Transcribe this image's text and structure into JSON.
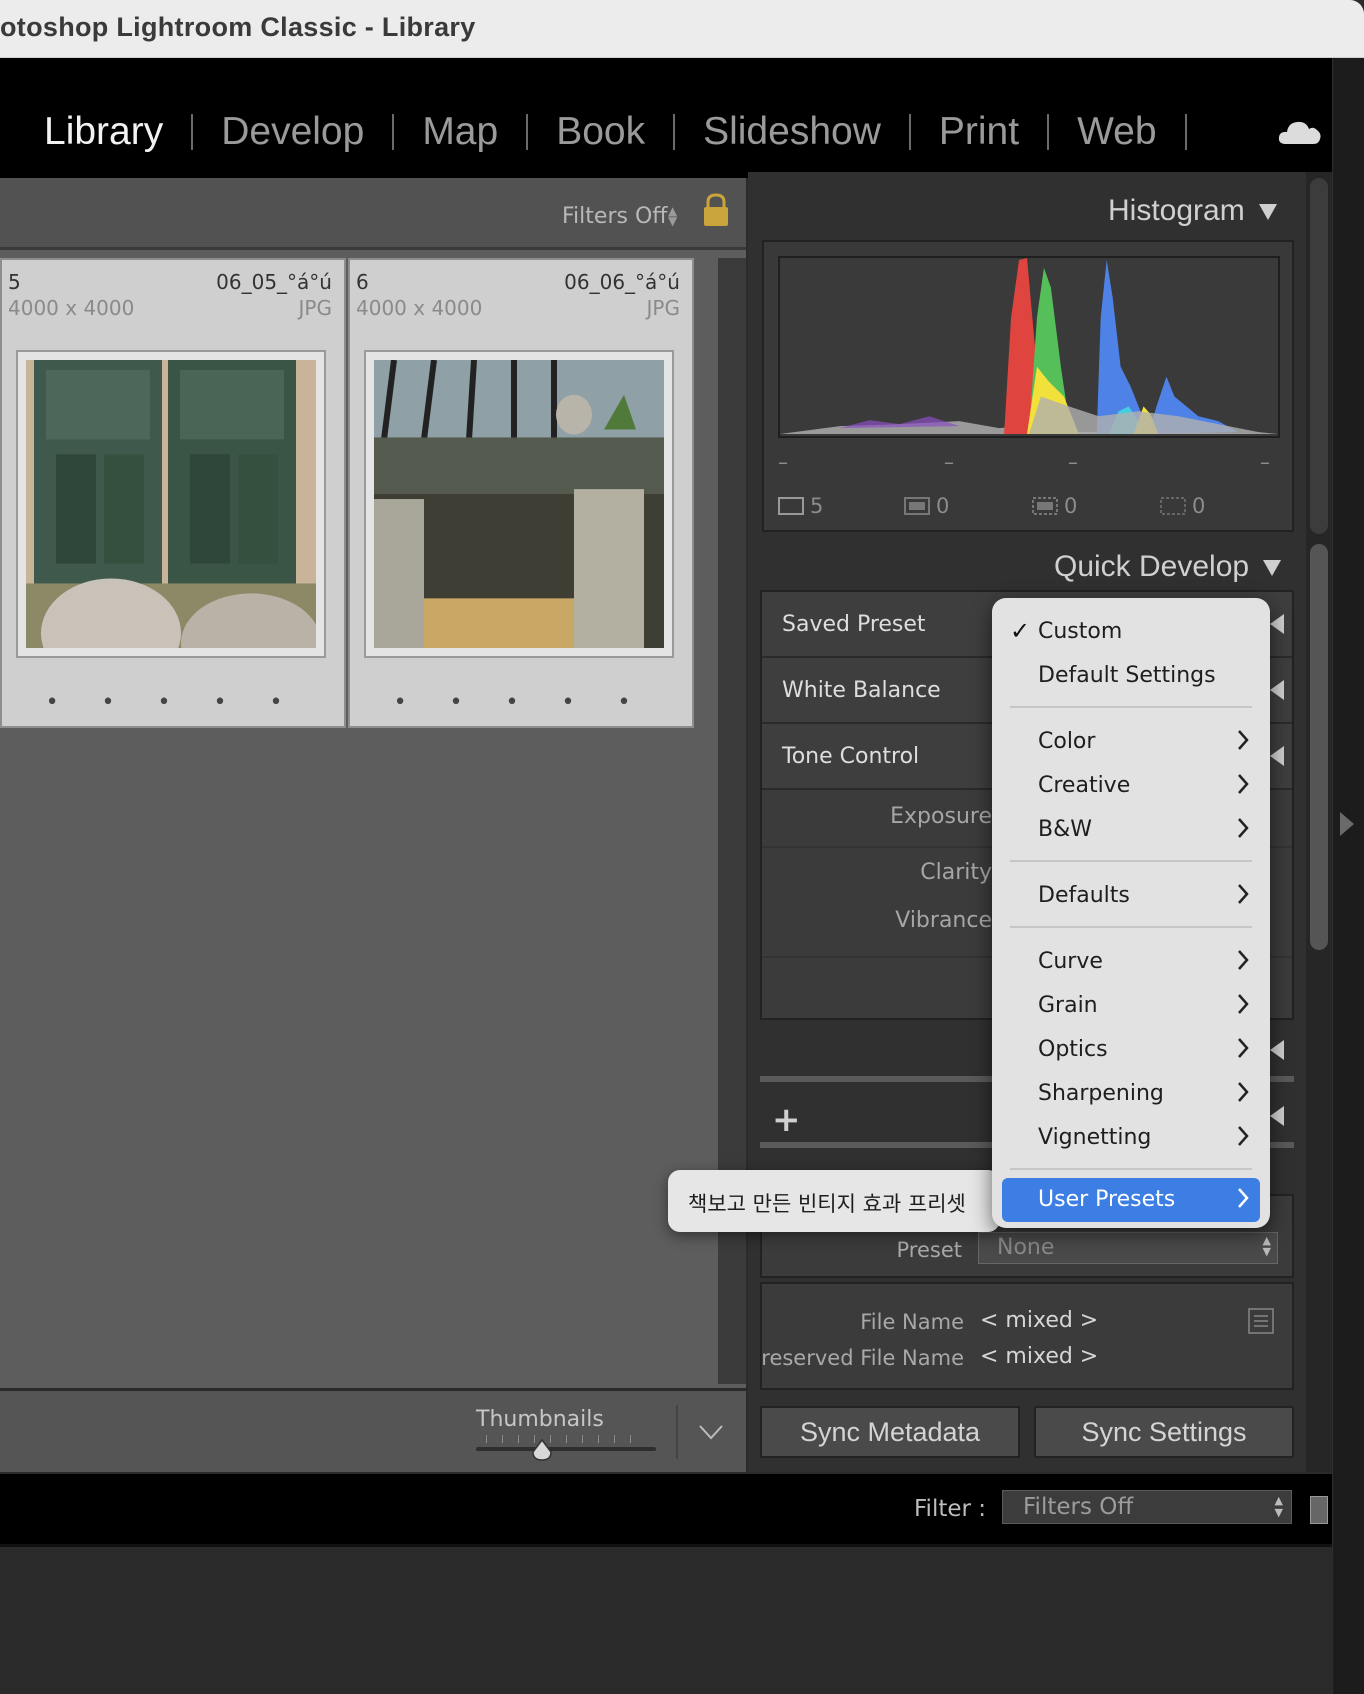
{
  "window": {
    "title": "otoshop Lightroom Classic - Library"
  },
  "modules": [
    "Library",
    "Develop",
    "Map",
    "Book",
    "Slideshow",
    "Print",
    "Web"
  ],
  "active_module": "Library",
  "grid": {
    "filter_label": "Filters Off",
    "cells": [
      {
        "index": "5",
        "filename": "06_05_°á°ú",
        "dimensions": "4000 x 4000",
        "filetype": "JPG",
        "rating_dots": "• • • • •"
      },
      {
        "index": "6",
        "filename": "06_06_°á°ú",
        "dimensions": "4000 x 4000",
        "filetype": "JPG",
        "rating_dots": "• • • • •"
      }
    ]
  },
  "toolbar": {
    "thumbnails_label": "Thumbnails",
    "thumbnail_size_value": 0.35
  },
  "histogram": {
    "title": "Histogram",
    "dashes": [
      "–",
      "–",
      "–",
      "–"
    ],
    "stats": [
      {
        "icon": "photo-frame-icon",
        "value": "5"
      },
      {
        "icon": "smart-preview-icon",
        "value": "0"
      },
      {
        "icon": "original-preview-icon",
        "value": "0"
      },
      {
        "icon": "missing-preview-icon",
        "value": "0"
      }
    ]
  },
  "quick_develop": {
    "title": "Quick Develop",
    "rows": [
      "Saved Preset",
      "White Balance",
      "Tone Control"
    ],
    "sub_labels": [
      "Exposure",
      "Clarity",
      "Vibrance"
    ]
  },
  "metadata": {
    "preset_label": "Preset",
    "preset_value": "None",
    "fields": [
      {
        "label": "File Name",
        "value": "< mixed >"
      },
      {
        "label": "Preserved File Name",
        "value": "< mixed >"
      }
    ]
  },
  "buttons": {
    "sync_metadata": "Sync Metadata",
    "sync_settings": "Sync Settings"
  },
  "filmstrip": {
    "filter_label": "Filter :",
    "filter_value": "Filters Off"
  },
  "preset_menu": {
    "items": [
      {
        "label": "Custom",
        "checked": true,
        "submenu": false
      },
      {
        "label": "Default Settings",
        "submenu": false
      },
      {
        "label": "Color",
        "submenu": true
      },
      {
        "label": "Creative",
        "submenu": true
      },
      {
        "label": "B&W",
        "submenu": true
      },
      {
        "label": "Defaults",
        "submenu": true
      },
      {
        "label": "Curve",
        "submenu": true
      },
      {
        "label": "Grain",
        "submenu": true
      },
      {
        "label": "Optics",
        "submenu": true
      },
      {
        "label": "Sharpening",
        "submenu": true
      },
      {
        "label": "Vignetting",
        "submenu": true
      },
      {
        "label": "User Presets",
        "submenu": true,
        "highlighted": true
      }
    ],
    "submenu_tooltip": "책보고 만든 빈티지 효과 프리셋"
  },
  "colors": {
    "menu_highlight": "#3d7ee5",
    "histogram_red": "#e0443f",
    "histogram_green": "#55c05a",
    "histogram_blue": "#4f82e6",
    "histogram_yellow": "#f2e13a"
  }
}
